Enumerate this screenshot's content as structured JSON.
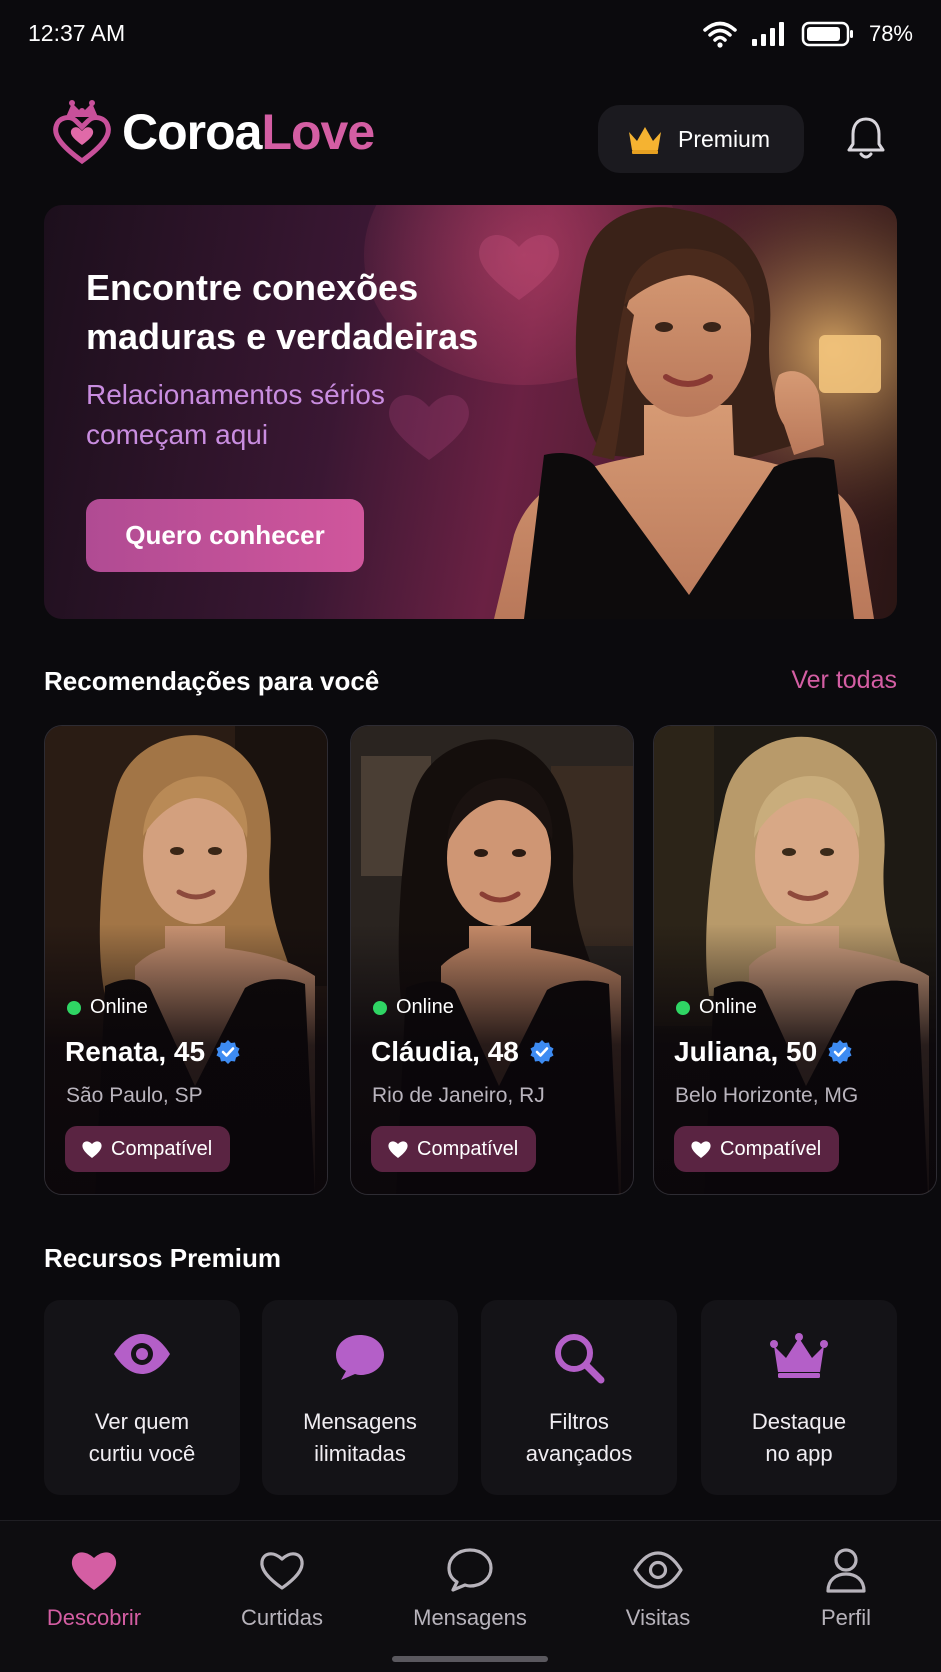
{
  "status_bar": {
    "time": "12:37 AM",
    "battery": "78%"
  },
  "header": {
    "brand_part1": "Coroa",
    "brand_part2": "Love",
    "premium_label": "Premium"
  },
  "hero": {
    "title": "Encontre conexões maduras e verdadeiras",
    "subtitle": "Relacionamentos sérios começam aqui",
    "cta": "Quero conhecer"
  },
  "recommendations": {
    "title": "Recomendações para você",
    "see_all": "Ver todas",
    "profiles": [
      {
        "status": "Online",
        "name": "Renata, 45",
        "city": "São Paulo, SP",
        "badge": "Compatível"
      },
      {
        "status": "Online",
        "name": "Cláudia, 48",
        "city": "Rio de Janeiro, RJ",
        "badge": "Compatível"
      },
      {
        "status": "Online",
        "name": "Juliana, 50",
        "city": "Belo Horizonte, MG",
        "badge": "Compatível"
      }
    ]
  },
  "premium_features": {
    "title": "Recursos Premium",
    "items": [
      {
        "icon": "eye-icon",
        "line1": "Ver quem",
        "line2": "curtiu você"
      },
      {
        "icon": "chat-bubble-icon",
        "line1": "Mensagens",
        "line2": "ilimitadas"
      },
      {
        "icon": "search-icon",
        "line1": "Filtros",
        "line2": "avançados"
      },
      {
        "icon": "crown-icon",
        "line1": "Destaque",
        "line2": "no app"
      }
    ]
  },
  "bottom_nav": {
    "active": "Descobrir",
    "items": [
      {
        "icon": "heart-filled-icon",
        "label": "Descobrir"
      },
      {
        "icon": "heart-outline-icon",
        "label": "Curtidas"
      },
      {
        "icon": "chat-icon",
        "label": "Mensagens"
      },
      {
        "icon": "eye-icon",
        "label": "Visitas"
      },
      {
        "icon": "person-icon",
        "label": "Perfil"
      }
    ]
  },
  "colors": {
    "accent": "#d45ea3",
    "accent_purple": "#b45fc8",
    "online": "#2fd564",
    "verified": "#3d8bf2",
    "background": "#0b0a0d"
  }
}
